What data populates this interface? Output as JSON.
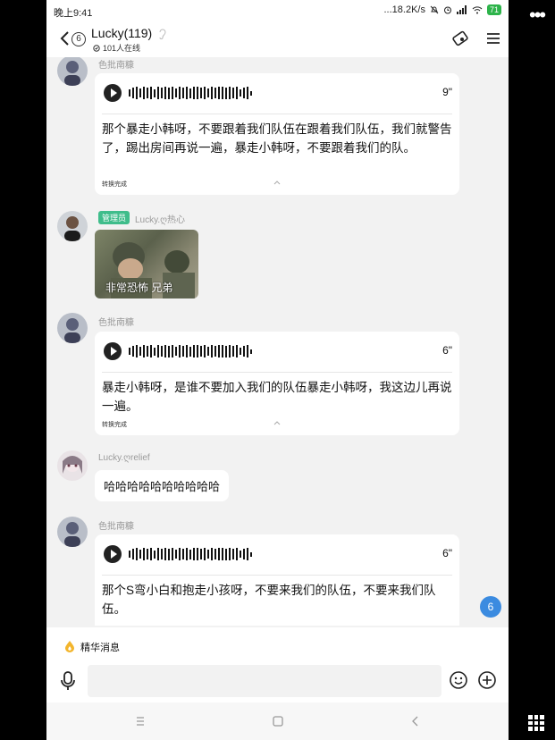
{
  "status": {
    "time": "晚上9:41",
    "speed": "...18.2K/s",
    "battery": "71"
  },
  "header": {
    "title": "Lucky(119)",
    "back_count": "6",
    "online": "101人在线"
  },
  "messages": [
    {
      "name": "色批南糠",
      "duration": "9\"",
      "text": "那个暴走小韩呀，不要跟着我们队伍在跟着我们队伍，我们就警告了，踢出房间再说一遍，暴走小韩呀，不要跟着我们的队。",
      "status": "转换完成"
    },
    {
      "admin_tag": "管理员",
      "name": "Lucky.ღ热心",
      "image_caption": "非常恐怖  兄弟"
    },
    {
      "name": "色批南糠",
      "duration": "6\"",
      "text": "暴走小韩呀，是谁不要加入我们的队伍暴走小韩呀，我这边儿再说一遍。",
      "status": "转换完成"
    },
    {
      "name": "Lucky.ღrelief",
      "text": "哈哈哈哈哈哈哈哈哈哈"
    },
    {
      "name": "色批南糠",
      "duration": "6\"",
      "text": "那个S弯小白和抱走小孩呀，不要来我们的队伍，不要来我们队伍。"
    }
  ],
  "unread_count": "6",
  "essence_label": "精华消息",
  "input": {
    "placeholder": ""
  }
}
